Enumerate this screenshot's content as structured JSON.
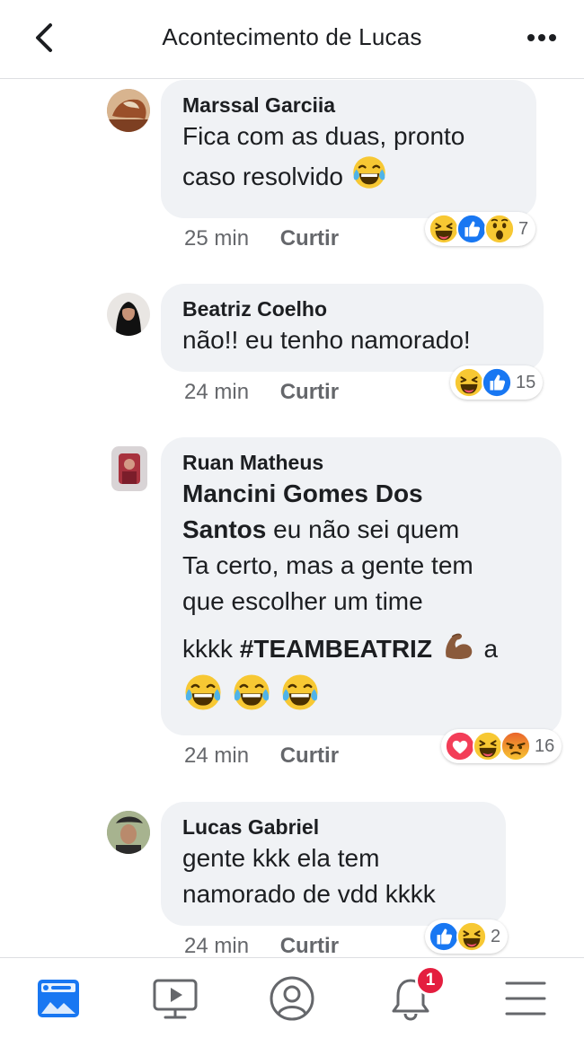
{
  "header": {
    "title": "Acontecimento de Lucas",
    "back_icon": "chevron-left-icon",
    "more_icon": "more-dots-icon"
  },
  "comments": [
    {
      "author": "Marssal Garciia",
      "text_line1": "Fica com as duas, pronto",
      "text_line2": "caso resolvido",
      "time": "25 min",
      "like_label": "Curtir",
      "reactions": [
        "haha",
        "like",
        "wow"
      ],
      "reaction_count": "7"
    },
    {
      "author": "Beatriz Coelho",
      "text_line1": "não!! eu tenho namorado!",
      "time": "24 min",
      "like_label": "Curtir",
      "reactions": [
        "haha",
        "like"
      ],
      "reaction_count": "15"
    },
    {
      "author": "Ruan Matheus",
      "mention_part1": "Mancini Gomes Dos",
      "mention_part2": "Santos",
      "text_line2": " eu não sei quem",
      "text_line3": "Ta certo, mas a gente tem",
      "text_line4": "que escolher um time",
      "text_line5_plain": "kkkk ",
      "hashtag": "#TEAMBEATRIZ",
      "text_line5_tail": " a",
      "time": "24 min",
      "like_label": "Curtir",
      "reactions": [
        "love",
        "haha",
        "angry"
      ],
      "reaction_count": "16"
    },
    {
      "author": "Lucas Gabriel",
      "text_line1": "gente kkk ela tem",
      "text_line2": "namorado de vdd kkkk",
      "time": "24 min",
      "like_label": "Curtir",
      "reactions": [
        "like",
        "haha"
      ],
      "reaction_count": "2"
    }
  ],
  "bottom_nav": {
    "items": [
      "news-feed-icon",
      "watch-video-icon",
      "profile-icon",
      "notifications-bell-icon",
      "menu-icon"
    ],
    "notification_badge": "1"
  },
  "colors": {
    "accent": "#1877f2",
    "bubble": "#f0f2f5",
    "badge": "#e41e3f"
  }
}
